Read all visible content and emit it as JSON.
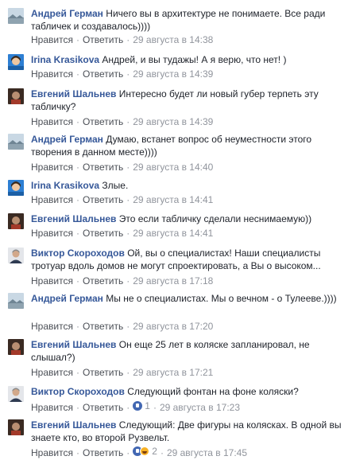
{
  "actions": {
    "like": "Нравится",
    "reply": "Ответить",
    "sep": "·"
  },
  "comments": [
    {
      "author": "Андрей Герман",
      "text": "Ничего вы в архитектуре не понимаете. Все ради табличек и создавалось))))",
      "time": "29 августа в 14:38",
      "avatar": "landscape-avatar"
    },
    {
      "author": "Irina Krasikova",
      "text": "Андрей, и вы тудажы! А я верю, что нет! )",
      "time": "29 августа в 14:39",
      "avatar": "blue-avatar"
    },
    {
      "author": "Евгений Шальнев",
      "text": "Интересно будет ли новый губер терпеть эту табличку?",
      "time": "29 августа в 14:39",
      "avatar": "dark-avatar"
    },
    {
      "author": "Андрей Герман",
      "text": "Думаю, встанет вопрос об неуместности этого творения в данном месте))))",
      "time": "29 августа в 14:40",
      "avatar": "landscape-avatar"
    },
    {
      "author": "Irina Krasikova",
      "text": "Злые.",
      "time": "29 августа в 14:41",
      "avatar": "blue-avatar"
    },
    {
      "author": "Евгений Шальнев",
      "text": "Это если табличку сделали неснимаемую))",
      "time": "29 августа в 14:41",
      "avatar": "dark-avatar"
    },
    {
      "author": "Виктор Скороходов",
      "text": "Ой, вы о специалистах! Наши специалисты тротуар вдоль домов не могут спроектировать, а Вы о высоком...",
      "time": "29 августа в 17:18",
      "avatar": "man-avatar"
    },
    {
      "author": "Андрей Герман",
      "text": "Мы не о специалистах. Мы о вечном - о Тулееве.))))",
      "time": "29 августа в 17:20",
      "avatar": "landscape-avatar"
    },
    {
      "author": "Евгений Шальнев",
      "text": "Он еще 25 лет в коляске запланировал, не слышал?)",
      "time": "29 августа в 17:21",
      "avatar": "dark-avatar"
    },
    {
      "author": "Виктор Скороходов",
      "text": "Следующий фонтан на фоне коляски?",
      "time": "29 августа в 17:23",
      "avatar": "man-avatar",
      "reactions": {
        "count": "1",
        "icons": [
          "like-reaction-icon"
        ]
      }
    },
    {
      "author": "Евгений Шальнев",
      "text": "Следующий: Две фигуры на колясках. В одной вы знаете кто, во второй Рузвельт.",
      "time": "29 августа в 17:45",
      "avatar": "dark-avatar",
      "reactions": {
        "count": "2",
        "icons": [
          "like-reaction-icon",
          "laugh-reaction-icon"
        ]
      }
    }
  ]
}
